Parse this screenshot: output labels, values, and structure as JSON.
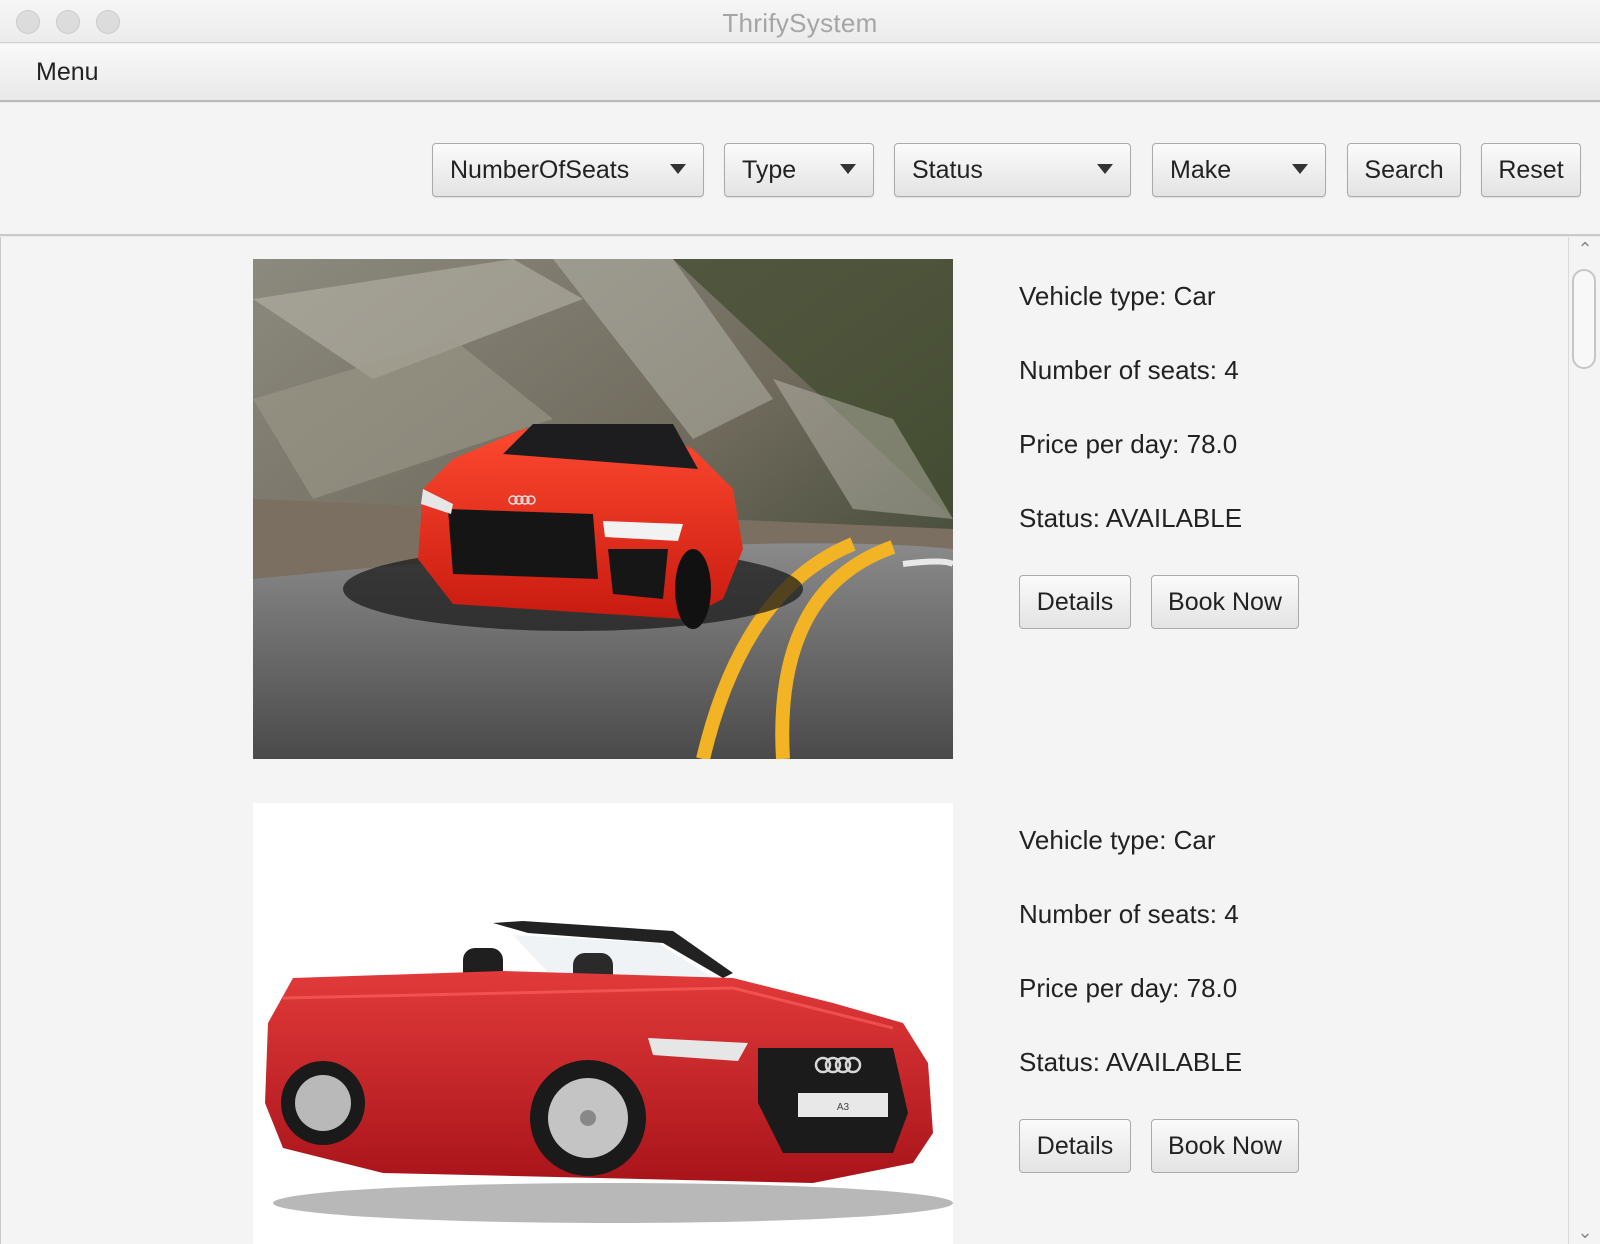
{
  "window": {
    "title": "ThrifySystem"
  },
  "menubar": {
    "items": [
      {
        "label": "Menu"
      }
    ]
  },
  "toolbar": {
    "filters": [
      {
        "label": "NumberOfSeats"
      },
      {
        "label": "Type"
      },
      {
        "label": "Status"
      },
      {
        "label": "Make"
      }
    ],
    "search_label": "Search",
    "reset_label": "Reset"
  },
  "vehicles": [
    {
      "image": "red-sports-car-on-mountain-road",
      "type_text": "Vehicle type: Car",
      "seats_text": "Number of seats: 4",
      "price_text": "Price per day: 78.0",
      "status_text": "Status: AVAILABLE",
      "details_label": "Details",
      "book_label": "Book Now"
    },
    {
      "image": "red-convertible-car",
      "type_text": "Vehicle type: Car",
      "seats_text": "Number of seats: 4",
      "price_text": "Price per day: 78.0",
      "status_text": "Status: AVAILABLE",
      "details_label": "Details",
      "book_label": "Book Now",
      "plate_text": "A3"
    }
  ],
  "colors": {
    "car_red": "#e0241c",
    "road_yellow": "#f2b424",
    "background": "#f4f4f4"
  }
}
